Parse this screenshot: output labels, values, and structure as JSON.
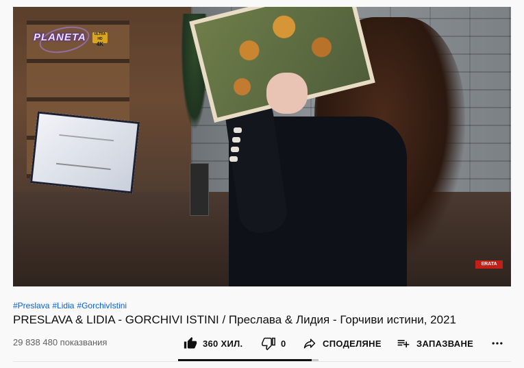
{
  "video": {
    "channel_logo_text": "PLANETA",
    "logo_badge": "4K",
    "corner_badge": "ERATA"
  },
  "hashtags": [
    "#Preslava",
    "#Lidia",
    "#GorchivIstini"
  ],
  "title": "PRESLAVA & LIDIA - GORCHIVI ISTINI / Преслава & Лидия - Горчиви истини, 2021",
  "views": "29 838 480 показвания",
  "actions": {
    "like_count": "360 ХИЛ.",
    "dislike_count": "0",
    "share_label": "СПОДЕЛЯНЕ",
    "save_label": "ЗАПАЗВАНЕ",
    "more_label": "..."
  },
  "sentiment_like_ratio": 0.95,
  "icons": {
    "like": "thumbs-up-icon",
    "dislike": "thumbs-down-icon",
    "share": "share-arrow-icon",
    "save": "playlist-add-icon",
    "more": "more-horizontal-icon"
  }
}
